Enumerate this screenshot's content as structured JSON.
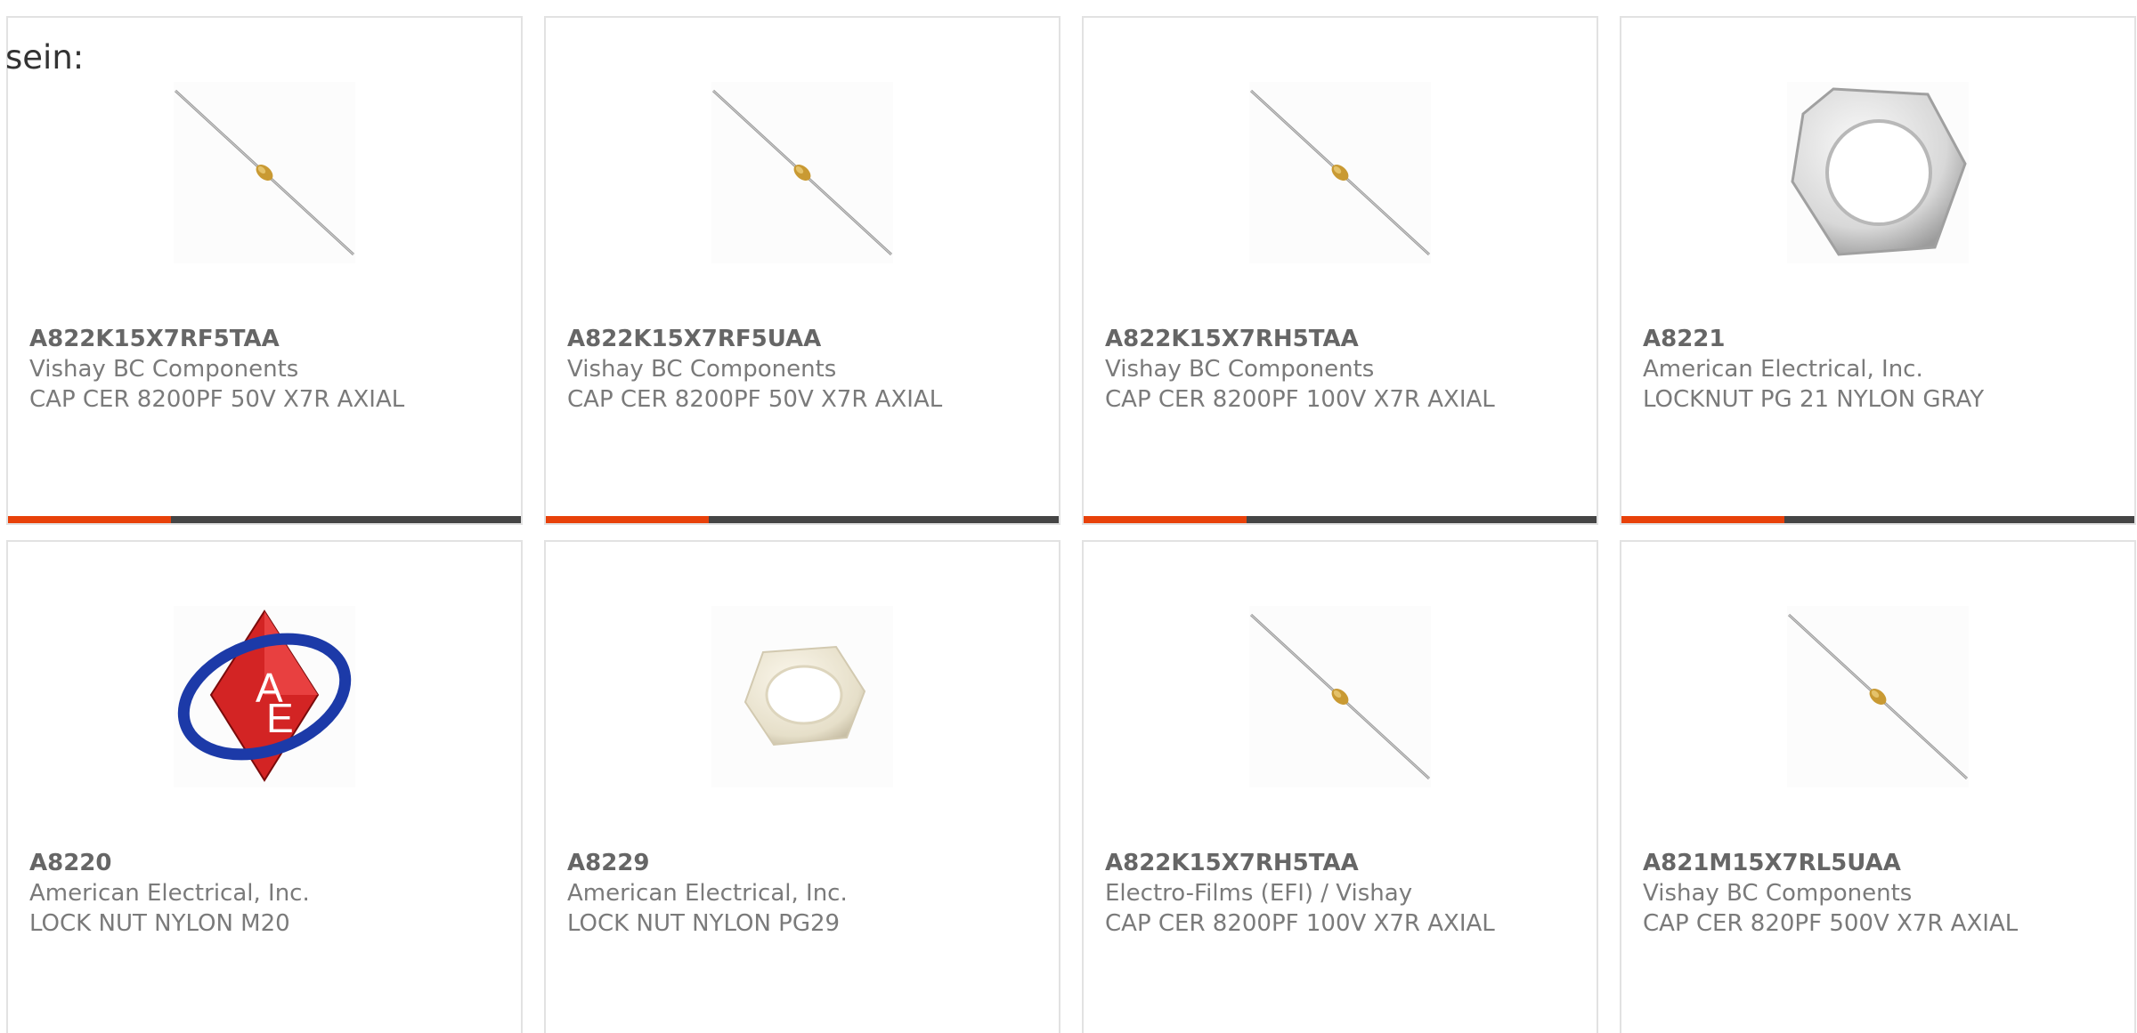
{
  "lead_text": "sein:",
  "colors": {
    "card_border": "#e2e2e2",
    "bar_dark": "#454545",
    "bar_accent": "#e8410a",
    "text_gray": "#7a7a7a"
  },
  "products": [
    {
      "part": "A822K15X7RF5TAA",
      "maker": "Vishay BC Components",
      "desc": "CAP CER 8200PF 50V X7R AXIAL",
      "image": "axial-capacitor-icon",
      "bar": true
    },
    {
      "part": "A822K15X7RF5UAA",
      "maker": "Vishay BC Components",
      "desc": "CAP CER 8200PF 50V X7R AXIAL",
      "image": "axial-capacitor-icon",
      "bar": true
    },
    {
      "part": "A822K15X7RH5TAA",
      "maker": "Vishay BC Components",
      "desc": "CAP CER 8200PF 100V X7R AXIAL",
      "image": "axial-capacitor-icon",
      "bar": true
    },
    {
      "part": "A8221",
      "maker": "American Electrical, Inc.",
      "desc": "LOCKNUT PG 21 NYLON GRAY",
      "image": "gray-locknut-icon",
      "bar": true
    },
    {
      "part": "A8220",
      "maker": "American Electrical, Inc.",
      "desc": "LOCK NUT NYLON M20",
      "image": "ae-logo-icon",
      "bar": false
    },
    {
      "part": "A8229",
      "maker": "American Electrical, Inc.",
      "desc": "LOCK NUT NYLON PG29",
      "image": "white-locknut-icon",
      "bar": false
    },
    {
      "part": "A822K15X7RH5TAA",
      "maker": "Electro-Films (EFI) / Vishay",
      "desc": "CAP CER 8200PF 100V X7R AXIAL",
      "image": "axial-capacitor-icon",
      "bar": false
    },
    {
      "part": "A821M15X7RL5UAA",
      "maker": "Vishay BC Components",
      "desc": "CAP CER 820PF 500V X7R AXIAL",
      "image": "axial-capacitor-icon",
      "bar": false
    }
  ]
}
